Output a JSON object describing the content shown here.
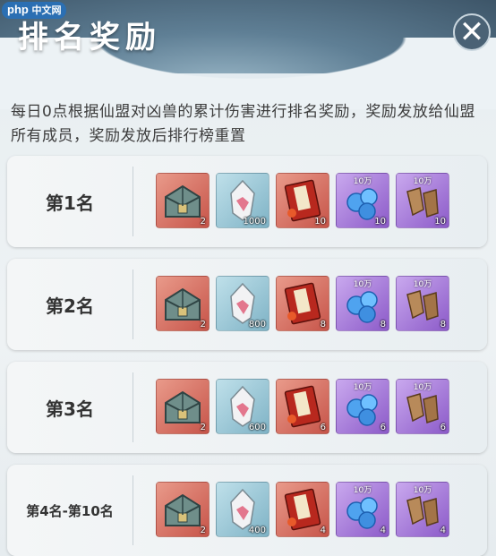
{
  "site_badge": {
    "php": "php",
    "zh": "中文网"
  },
  "title": "排名奖励",
  "close_label": "✕",
  "description": "每日0点根据仙盟对凶兽的累计伤害进行排名奖励，奖励发放给仙盟所有成员，奖励发放后排行榜重置",
  "item_icons": [
    "chest-icon",
    "crystal-icon",
    "book-icon",
    "blue-gem-icon",
    "gloves-icon"
  ],
  "ranks": [
    {
      "label": "第1名",
      "items": [
        "2",
        "1000",
        "10",
        "10",
        "10"
      ],
      "tags": [
        "",
        "",
        "",
        "10万",
        "10万"
      ]
    },
    {
      "label": "第2名",
      "items": [
        "2",
        "800",
        "8",
        "8",
        "8"
      ],
      "tags": [
        "",
        "",
        "",
        "10万",
        "10万"
      ]
    },
    {
      "label": "第3名",
      "items": [
        "2",
        "600",
        "6",
        "6",
        "6"
      ],
      "tags": [
        "",
        "",
        "",
        "10万",
        "10万"
      ]
    },
    {
      "label": "第4名-第10名",
      "items": [
        "2",
        "400",
        "4",
        "4",
        "4"
      ],
      "tags": [
        "",
        "",
        "",
        "10万",
        "10万"
      ]
    }
  ]
}
